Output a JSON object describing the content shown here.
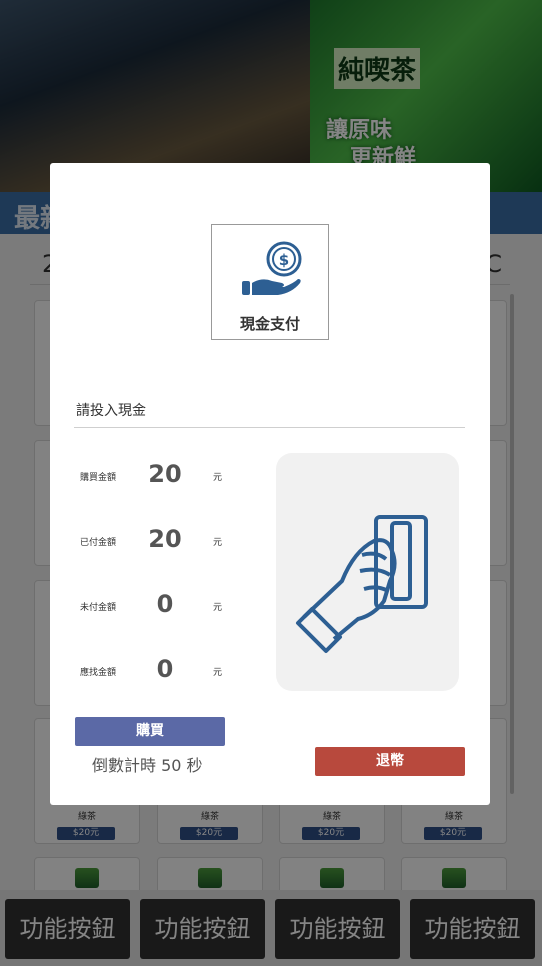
{
  "banner": {
    "tea_brand": "純喫茶",
    "tea_slogan_line1": "讓原味",
    "tea_slogan_line2": "更新鮮"
  },
  "section": {
    "title": "最新",
    "stats_left": "2",
    "stats_right": "C"
  },
  "products": [
    {
      "name": "綠茶",
      "price": "$20元"
    },
    {
      "name": "綠茶",
      "price": "$20元"
    },
    {
      "name": "綠茶",
      "price": "$20元"
    },
    {
      "name": "綠茶",
      "price": "$20元"
    }
  ],
  "function_buttons": [
    "功能按鈕",
    "功能按鈕",
    "功能按鈕",
    "功能按鈕"
  ],
  "modal": {
    "payment_method": "現金支付",
    "payment_icon": "cash-coin-hand-icon",
    "prompt": "請投入現金",
    "rows": [
      {
        "label": "購買金額",
        "value": "20",
        "unit": "元"
      },
      {
        "label": "已付金額",
        "value": "20",
        "unit": "元"
      },
      {
        "label": "未付金額",
        "value": "0",
        "unit": "元"
      },
      {
        "label": "應找金額",
        "value": "0",
        "unit": "元"
      }
    ],
    "illustration_icon": "hand-inserting-card-icon",
    "buy_label": "購買",
    "countdown_text": "倒數計時 50 秒",
    "refund_label": "退幣"
  },
  "colors": {
    "accent_blue": "#5b69a6",
    "refund_red": "#b8493d",
    "icon_blue": "#2d5f93",
    "section_blue": "#3a6ea5"
  }
}
